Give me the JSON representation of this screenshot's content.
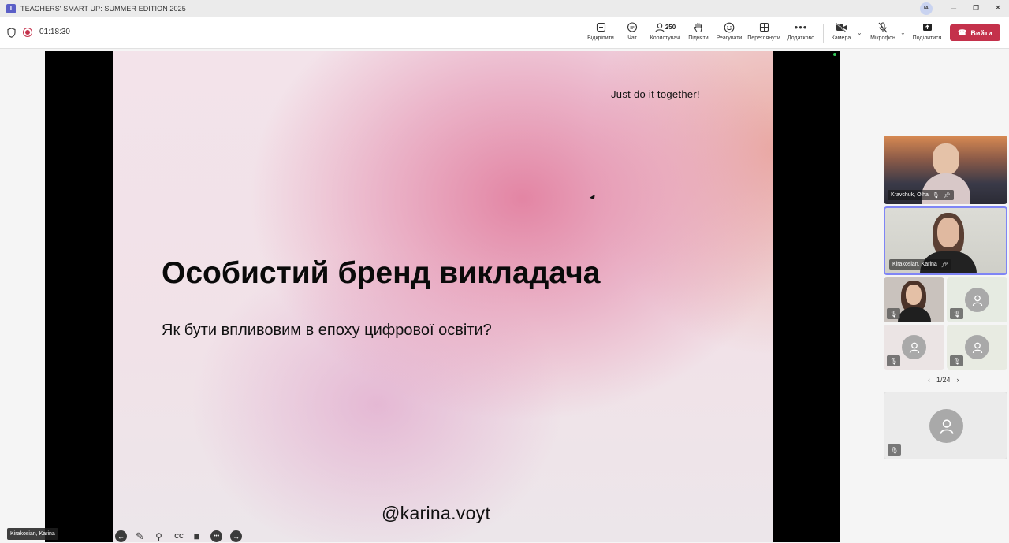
{
  "titlebar": {
    "title": "TEACHERS' SMART UP: SUMMER EDITION 2025",
    "user_initials": "IA",
    "minimize": "–",
    "restore": "❐",
    "close": "✕"
  },
  "toolbar": {
    "timer": "01:18:30",
    "buttons": [
      {
        "label": "Відкріпити",
        "icon": "unpin-icon"
      },
      {
        "label": "Чат",
        "icon": "chat-icon"
      },
      {
        "label": "Користувачі",
        "icon": "people-icon",
        "count": "250"
      },
      {
        "label": "Підняти",
        "icon": "raise-hand-icon"
      },
      {
        "label": "Реагувати",
        "icon": "react-icon"
      },
      {
        "label": "Переглянути",
        "icon": "view-icon"
      },
      {
        "label": "Додатково",
        "icon": "more-icon"
      },
      {
        "label": "Камера",
        "icon": "camera-off-icon"
      },
      {
        "label": "Мікрофон",
        "icon": "mic-off-icon"
      },
      {
        "label": "Поділитися",
        "icon": "share-icon"
      }
    ],
    "leave_label": "Вийти"
  },
  "slide": {
    "tagline": "Just do it together!",
    "heading": "Особистий бренд викладача",
    "subtitle": "Як бути впливовим в епоху цифрової освіти?",
    "handle": "@karina.voyt"
  },
  "presenter": {
    "name": "Kirakosian, Karina"
  },
  "participants": {
    "tiles": [
      {
        "name": "Kravchuk, Olha"
      },
      {
        "name": "Kirakosian, Karina"
      }
    ],
    "pager": "1/24"
  },
  "colors": {
    "accent": "#5b5fc7",
    "leave": "#c4314b",
    "active_border": "#7f85f5"
  }
}
